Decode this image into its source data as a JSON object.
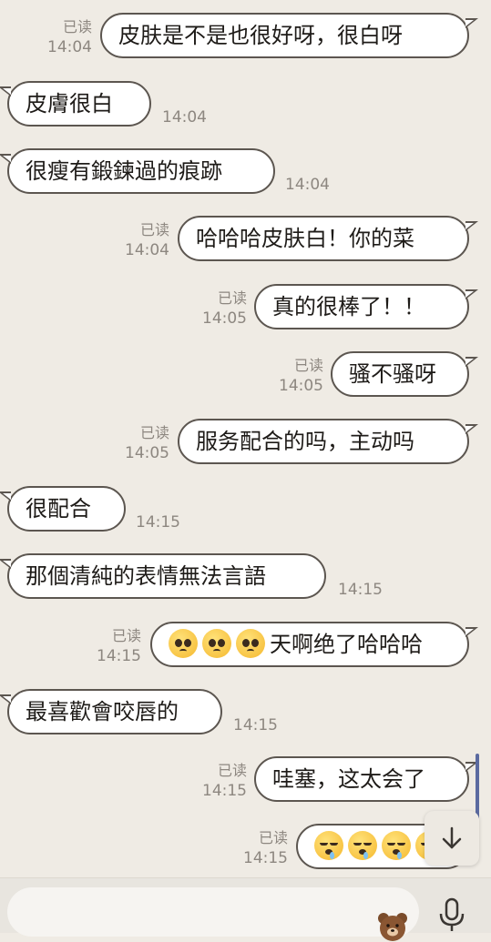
{
  "chat": {
    "messages": [
      {
        "dir": "out",
        "text": "皮肤是不是也很好呀，很白呀",
        "read": "已读",
        "time": "14:04"
      },
      {
        "dir": "in",
        "text": "皮膚很白",
        "time": "14:04"
      },
      {
        "dir": "in",
        "text": "很瘦有鍛鍊過的痕跡",
        "time": "14:04"
      },
      {
        "dir": "out",
        "text": "哈哈哈皮肤白！你的菜",
        "read": "已读",
        "time": "14:04"
      },
      {
        "dir": "out",
        "text": "真的很棒了！！",
        "read": "已读",
        "time": "14:05"
      },
      {
        "dir": "out",
        "text": "骚不骚呀",
        "read": "已读",
        "time": "14:05"
      },
      {
        "dir": "out",
        "text": "服务配合的吗，主动吗",
        "read": "已读",
        "time": "14:05"
      },
      {
        "dir": "in",
        "text": "很配合",
        "time": "14:15"
      },
      {
        "dir": "in",
        "text": "那個清純的表情無法言語",
        "time": "14:15"
      },
      {
        "dir": "out",
        "text": "天啊绝了哈哈哈",
        "emoji": [
          "pleading-face",
          "pleading-face",
          "pleading-face"
        ],
        "read": "已读",
        "time": "14:15"
      },
      {
        "dir": "in",
        "text": "最喜歡會咬唇的",
        "time": "14:15"
      },
      {
        "dir": "out",
        "text": "哇塞，这太会了",
        "read": "已读",
        "time": "14:15"
      },
      {
        "dir": "out",
        "text": "",
        "emoji": [
          "sleeping-face",
          "sleeping-face",
          "sleeping-face",
          "sleeping-face"
        ],
        "read": "已读",
        "time": "14:15"
      }
    ]
  },
  "controls": {
    "scroll_down_icon": "arrow-down-icon",
    "sticker_icon": "bear-sticker-icon",
    "mic_icon": "microphone-icon",
    "input_placeholder": ""
  },
  "colors": {
    "background": "#efebe4",
    "bubble_bg": "#ffffff",
    "bubble_border": "#5c5650",
    "meta_text": "#8d8780"
  }
}
